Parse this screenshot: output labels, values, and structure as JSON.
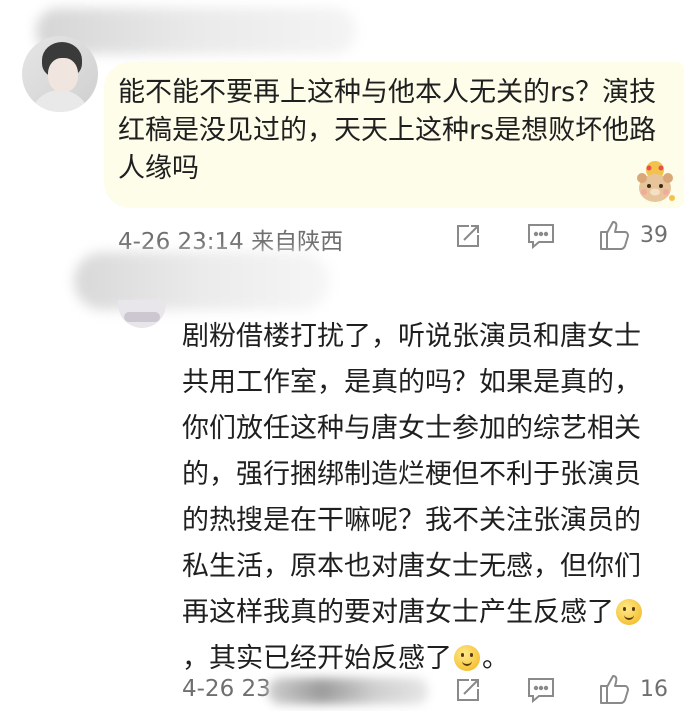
{
  "comments": [
    {
      "text": "能不能不要再上这种与他本人无关的rs？演技红稿是没见过的，天天上这种rs是想败坏他路人缘吗",
      "time": "4-26 23:14",
      "location": "来自陕西",
      "likes": "39"
    },
    {
      "segments": [
        "剧粉借楼打扰了，听说张演员和唐女士共用工作室，是真的吗？如果是真的，你们放任这种与唐女士参加的综艺相关的，强行捆绑制造烂梗但不利于张演员的热搜是在干嘛呢？我不关注张演员的私生活，原本也对唐女士无感，但你们再这样我真的要对唐女士产生反感了",
        "，其实已经开始反感了",
        "。"
      ],
      "time": "4-26 23",
      "likes": "16"
    }
  ],
  "icons": {
    "share": "share-icon",
    "comment": "comment-icon",
    "like": "thumbs-up-icon",
    "emoji": "smile-emoji",
    "sticker": "bear-sticker"
  },
  "colors": {
    "bubble_bg": "#fdfdea",
    "text": "#1f1f1f",
    "meta": "#6f6f6f"
  }
}
